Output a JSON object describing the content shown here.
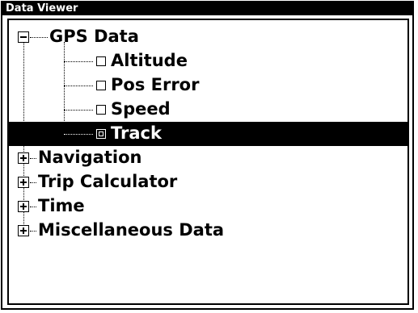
{
  "window": {
    "title": "Data Viewer"
  },
  "tree": {
    "items": [
      {
        "label": "GPS Data",
        "expanded": true,
        "children": [
          {
            "label": "Altitude",
            "selected": false
          },
          {
            "label": "Pos Error",
            "selected": false
          },
          {
            "label": "Speed",
            "selected": false
          },
          {
            "label": "Track",
            "selected": true
          }
        ]
      },
      {
        "label": "Navigation",
        "expanded": false
      },
      {
        "label": "Trip Calculator",
        "expanded": false
      },
      {
        "label": "Time",
        "expanded": false
      },
      {
        "label": "Miscellaneous Data",
        "expanded": false
      }
    ]
  },
  "colors": {
    "background": "#ffffff",
    "foreground": "#000000",
    "selection": "#000000"
  }
}
